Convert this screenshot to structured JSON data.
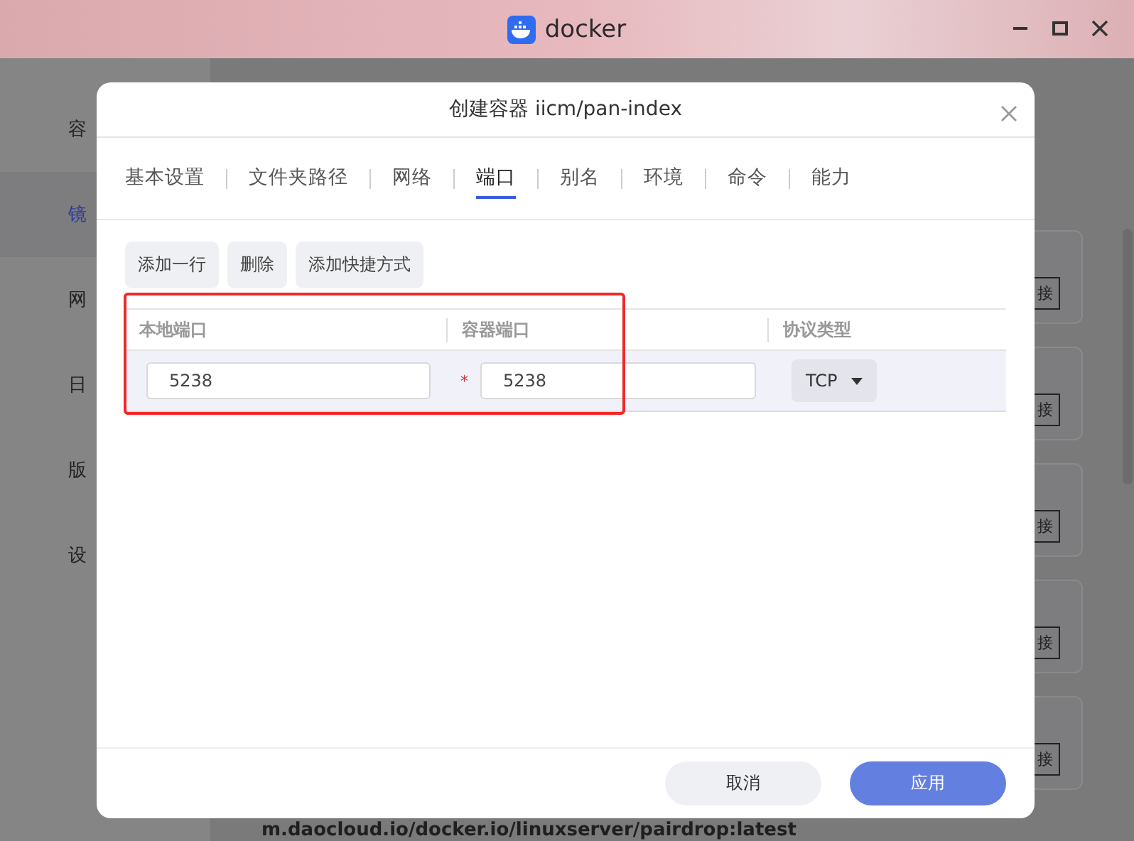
{
  "window": {
    "title": "docker"
  },
  "sidebar": {
    "items": [
      {
        "label": "容",
        "selected": false
      },
      {
        "label": "镜",
        "selected": true
      },
      {
        "label": "网",
        "selected": false
      },
      {
        "label": "日",
        "selected": false
      },
      {
        "label": "版",
        "selected": false
      },
      {
        "label": "设",
        "selected": false
      }
    ]
  },
  "cards": [
    {
      "button": "接"
    },
    {
      "button": "接"
    },
    {
      "button": "接"
    },
    {
      "button": "接"
    },
    {
      "button": "接"
    }
  ],
  "footer_text": "m.daocloud.io/docker.io/linuxserver/pairdrop:latest",
  "dialog": {
    "title": "创建容器 iicm/pan-index",
    "tabs": [
      {
        "label": "基本设置",
        "selected": false
      },
      {
        "label": "文件夹路径",
        "selected": false
      },
      {
        "label": "网络",
        "selected": false
      },
      {
        "label": "端口",
        "selected": true
      },
      {
        "label": "别名",
        "selected": false
      },
      {
        "label": "环境",
        "selected": false
      },
      {
        "label": "命令",
        "selected": false
      },
      {
        "label": "能力",
        "selected": false
      }
    ],
    "toolbar": [
      "添加一行",
      "删除",
      "添加快捷方式"
    ],
    "table": {
      "columns": [
        "本地端口",
        "容器端口",
        "协议类型"
      ],
      "rows": [
        {
          "local_port": "5238",
          "container_port": "5238",
          "container_port_required": true,
          "required_mark": "*",
          "protocol": "TCP"
        }
      ]
    },
    "buttons": [
      {
        "label": "取消",
        "kind": "secondary"
      },
      {
        "label": "应用",
        "kind": "primary"
      }
    ]
  }
}
